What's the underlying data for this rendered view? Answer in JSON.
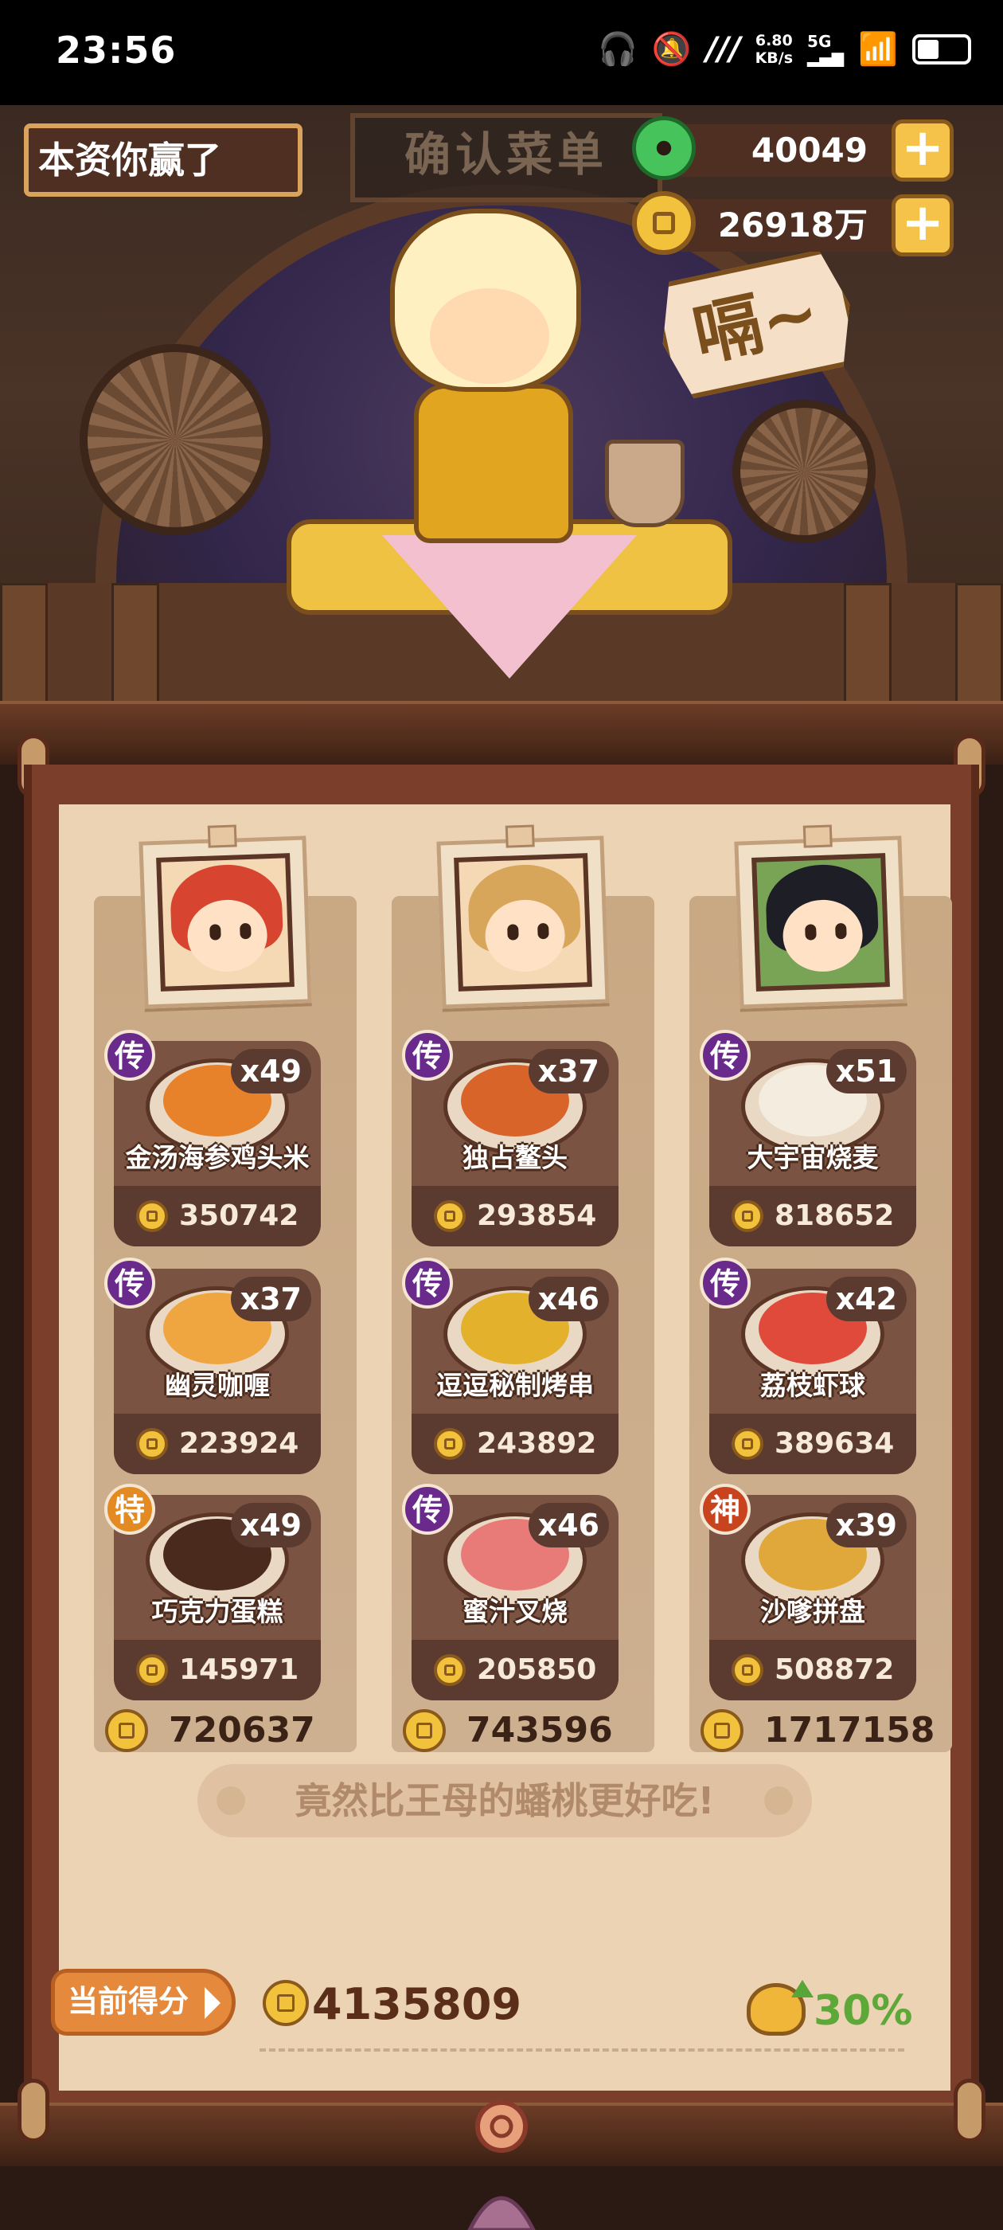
{
  "status_bar": {
    "time": "23:56",
    "net_speed_value": "6.80",
    "net_speed_unit": "KB/s",
    "signal_label": "5G"
  },
  "header": {
    "title": "本资你赢了",
    "signboard": "确认菜单",
    "jade_amount": "40049",
    "coin_amount": "26918万",
    "speech": "嗝~"
  },
  "chefs": [
    {
      "portrait": "chef-red-hair",
      "dishes": [
        {
          "grade": "传",
          "name": "金汤海参鸡头米",
          "qty": "x49",
          "price": "350742"
        },
        {
          "grade": "传",
          "name": "幽灵咖喱",
          "qty": "x37",
          "price": "223924"
        },
        {
          "grade": "特",
          "name": "巧克力蛋糕",
          "qty": "x49",
          "price": "145971"
        }
      ],
      "total": "720637"
    },
    {
      "portrait": "chef-blond-hair",
      "dishes": [
        {
          "grade": "传",
          "name": "独占鳌头",
          "qty": "x37",
          "price": "293854"
        },
        {
          "grade": "传",
          "name": "逗逗秘制烤串",
          "qty": "x46",
          "price": "243892"
        },
        {
          "grade": "传",
          "name": "蜜汁叉烧",
          "qty": "x46",
          "price": "205850"
        }
      ],
      "total": "743596"
    },
    {
      "portrait": "chef-black-hair",
      "dishes": [
        {
          "grade": "传",
          "name": "大宇宙烧麦",
          "qty": "x51",
          "price": "818652"
        },
        {
          "grade": "传",
          "name": "荔枝虾球",
          "qty": "x42",
          "price": "389634"
        },
        {
          "grade": "神",
          "name": "沙嗲拼盘",
          "qty": "x39",
          "price": "508872"
        }
      ],
      "total": "1717158"
    }
  ],
  "comment": "竟然比王母的蟠桃更好吃!",
  "footer": {
    "score_label": "当前得分",
    "score": "4135809",
    "bonus_percent": "30%"
  },
  "colors": {
    "grade_chuan": "#6a2a8c",
    "grade_te": "#e38b22",
    "grade_shen": "#c8441e",
    "bonus_green": "#5ea83a",
    "plus_button": "#f5c34a"
  }
}
